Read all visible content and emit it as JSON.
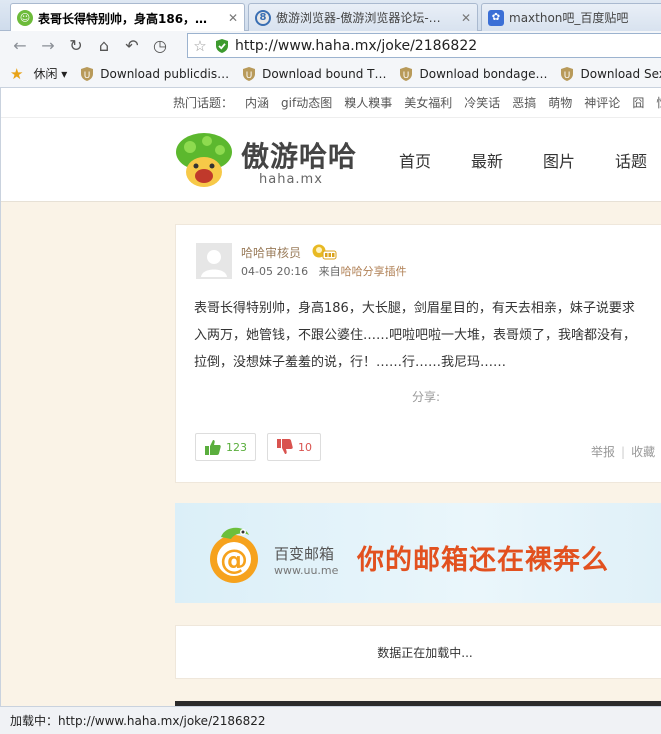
{
  "tabs": [
    {
      "title": "表哥长得特别帅，身高186，…",
      "active": true,
      "icon": "mushroom-favicon"
    },
    {
      "title": "傲游浏览器-傲游浏览器论坛-…",
      "active": false,
      "icon": "maxthon-favicon"
    },
    {
      "title": "maxthon吧_百度贴吧",
      "active": false,
      "icon": "baidu-paw-favicon"
    }
  ],
  "address": {
    "url": "http://www.haha.mx/joke/2186822"
  },
  "bookmarks": [
    {
      "label": "休闲 ▾",
      "icon": "star-icon"
    },
    {
      "label": "Download publicdis…",
      "icon": "download-shield-icon"
    },
    {
      "label": "Download bound T…",
      "icon": "download-shield-icon"
    },
    {
      "label": "Download bondage…",
      "icon": "download-shield-icon"
    },
    {
      "label": "Download SexAr",
      "icon": "download-shield-icon"
    }
  ],
  "site": {
    "hot_label": "热门话题：",
    "hot_topics": [
      "内涵",
      "gif动态图",
      "糗人糗事",
      "美女福利",
      "冷笑话",
      "恶搞",
      "萌物",
      "神评论",
      "囧",
      "惊"
    ],
    "brand": "傲游哈哈",
    "brand_sub": "haha.mx",
    "nav": [
      "首页",
      "最新",
      "图片",
      "话题"
    ]
  },
  "post": {
    "author": "哈哈审核员",
    "date": "04-05 20:16",
    "from_label": "来自",
    "from_source": "哈哈分享插件",
    "lines": [
      "表哥长得特别帅，身高186，大长腿，剑眉星目的，有天去相亲，妹子说要求",
      "入两万，她管钱，不跟公婆住……吧啦吧啦一大堆，表哥烦了，我啥都没有，",
      "拉倒，没想妹子羞羞的说，行！……行……我尼玛……"
    ],
    "share_label": "分享:",
    "likes": "123",
    "dislikes": "10",
    "report": "举报",
    "favorite": "收藏"
  },
  "banner": {
    "name": "百变邮箱",
    "site": "www.uu.me",
    "slogan": "你的邮箱还在裸奔么"
  },
  "loading": "数据正在加载中...",
  "status": "加载中：http://www.haha.mx/joke/2186822",
  "colors": {
    "accent_green": "#4aa43a",
    "like_green": "#5aae3d",
    "dislike_red": "#d9534f",
    "slogan_orange": "#e2511f"
  }
}
